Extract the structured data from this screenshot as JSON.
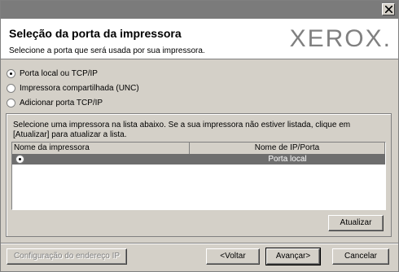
{
  "header": {
    "title": "Seleção da porta da impressora",
    "subtitle": "Selecione a porta que será usada por sua impressora.",
    "logo": "XEROX."
  },
  "port_options": [
    {
      "label": "Porta local ou TCP/IP",
      "selected": true
    },
    {
      "label": "Impressora compartilhada (UNC)",
      "selected": false
    },
    {
      "label": "Adicionar porta TCP/IP",
      "selected": false
    }
  ],
  "printer_list": {
    "instruction": "Selecione uma impressora na lista abaixo. Se a sua impressora não estiver listada, clique em [Atualizar] para atualizar a lista.",
    "columns": [
      "Nome da impressora",
      "Nome de IP/Porta"
    ],
    "rows": [
      {
        "name": "",
        "port": "Porta local",
        "selected": true
      }
    ],
    "refresh_label": "Atualizar"
  },
  "footer": {
    "ip_config_label": "Configuração do endereço IP",
    "back_label": "<Voltar",
    "next_label": "Avançar>",
    "cancel_label": "Cancelar"
  },
  "colors": {
    "dialog_bg": "#d4d0c8",
    "titlebar": "#7b7b7b",
    "selection": "#6e6e6e"
  }
}
